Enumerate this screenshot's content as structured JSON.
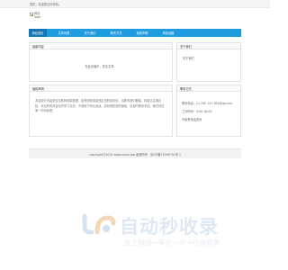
{
  "topbar": {
    "message": "您好，欢迎您访问本站。"
  },
  "logo": {
    "alt": "网站logo"
  },
  "nav": {
    "items": [
      {
        "label": "网站首页",
        "active": true
      },
      {
        "label": "文章列表",
        "active": false
      },
      {
        "label": "关于我们",
        "active": false
      },
      {
        "label": "联系方式",
        "active": false
      },
      {
        "label": "版权声明",
        "active": false
      },
      {
        "label": "网站地图",
        "active": false
      }
    ]
  },
  "main_panel": {
    "title": "最新内容",
    "empty_text": "在此页面中，暂无文章..."
  },
  "about_panel": {
    "title": "关于我们",
    "text": "关于我们"
  },
  "copyright_panel": {
    "title": "版权声明",
    "text": "本站部分内容来自互联网收集整理，如有侵权或者违反您的权利的，请联系我们删除。转载请注明出处，本站所有内容仅供学习交流，不得用于商业用途。如有侵犯您的版权，请及时联系本站，我们将在第一时间处理。"
  },
  "contact_panel": {
    "title": "联系方式",
    "lines": [
      "联系电话：21 205 141  383@qq.com",
      "工作时间：9:00-18:00",
      "不接受电话咨询"
    ]
  },
  "footer": {
    "copyright": "copyright©2020 www.xxyzs.top 版权所有",
    "icp": "京ICP备17006791号-1"
  },
  "watermark": {
    "title": "自动秒收录",
    "subtitle": "放上链接→来访一次→自动收录"
  }
}
